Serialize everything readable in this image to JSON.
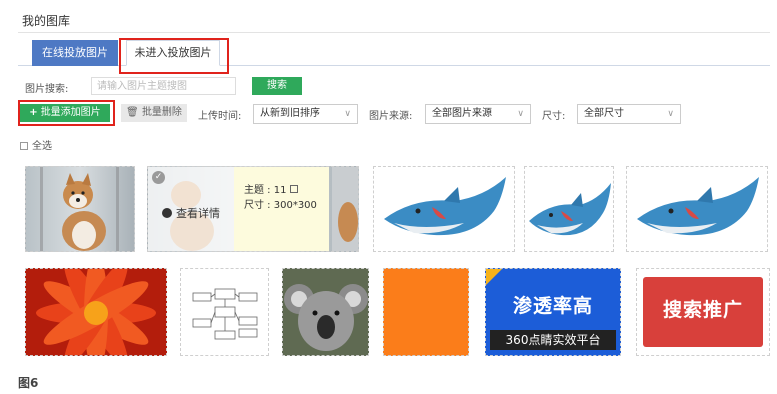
{
  "page": {
    "title": "我的图库",
    "caption": "图6"
  },
  "tabs": [
    {
      "label": "在线投放图片",
      "active": false
    },
    {
      "label": "未进入投放图片",
      "active": true
    }
  ],
  "search": {
    "label": "图片搜索:",
    "placeholder": "请输入图片主题搜图",
    "button": "搜索"
  },
  "toolbar": {
    "add_label": "批量添加图片",
    "delete_label": "批量删除",
    "upload_time_label": "上传时间:",
    "upload_time_value": "从新到旧排序",
    "source_label": "图片来源:",
    "source_value": "全部图片来源",
    "size_label": "尺寸:",
    "size_value": "全部尺寸"
  },
  "select_all": "全选",
  "hover_card": {
    "view_detail": "查看详情",
    "subject": "主题 : 11",
    "size": "尺寸 : 300*300"
  },
  "ads": {
    "blue_main": "渗透率高",
    "blue_sub": "360点睛实效平台",
    "red": "搜索推广"
  },
  "colors": {
    "primary_blue": "#4e79c4",
    "green": "#2fa95b",
    "highlight_red": "#e0231c"
  }
}
